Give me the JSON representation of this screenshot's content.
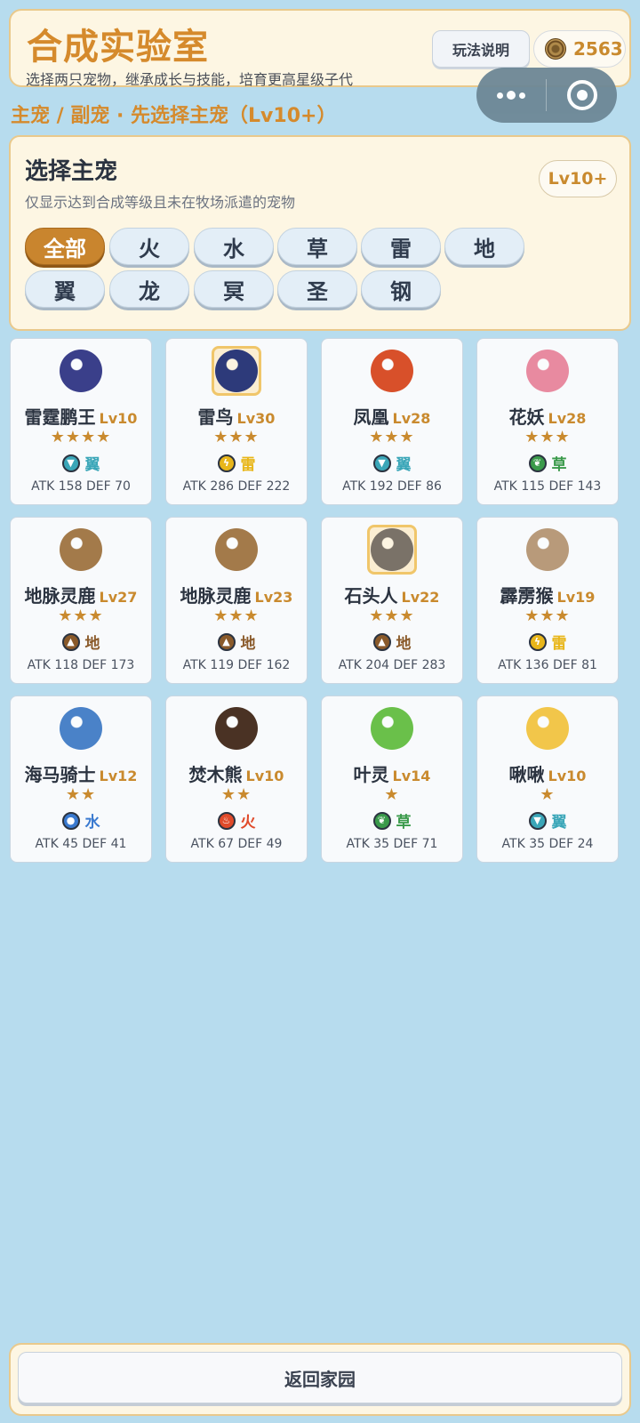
{
  "header": {
    "title": "合成实验室",
    "subtitle": "选择两只宠物，继承成长与技能，培育更高星级子代",
    "help_label": "玩法说明",
    "coins": "2563"
  },
  "breadcrumb": "主宠 / 副宠 · 先选择主宠（Lv10+）",
  "panel": {
    "title": "选择主宠",
    "desc": "仅显示达到合成等级且未在牧场派遣的宠物",
    "level_badge": "Lv10+",
    "filters": [
      "全部",
      "火",
      "水",
      "草",
      "雷",
      "地",
      "翼",
      "龙",
      "冥",
      "圣",
      "钢"
    ],
    "active_filter": "全部"
  },
  "pets": [
    {
      "name": "雷霆鹏王",
      "lv": "Lv10",
      "stars": "★★★★",
      "element": "翼",
      "stats": "ATK 158  DEF 70",
      "icon": "eagle-icon",
      "color": "#3a3f8a",
      "elem_color": "#3aa6b8",
      "framed": false
    },
    {
      "name": "雷鸟",
      "lv": "Lv30",
      "stars": "★★★",
      "element": "雷",
      "stats": "ATK 286  DEF 222",
      "icon": "thunderbird-icon",
      "color": "#2d3a7a",
      "elem_color": "#e8b61a",
      "framed": true
    },
    {
      "name": "凤凰",
      "lv": "Lv28",
      "stars": "★★★",
      "element": "翼",
      "stats": "ATK 192  DEF 86",
      "icon": "phoenix-icon",
      "color": "#d8502a",
      "elem_color": "#3aa6b8",
      "framed": false
    },
    {
      "name": "花妖",
      "lv": "Lv28",
      "stars": "★★★",
      "element": "草",
      "stats": "ATK 115  DEF 143",
      "icon": "flower-fairy-icon",
      "color": "#e88aa0",
      "elem_color": "#3a9a4a",
      "framed": false
    },
    {
      "name": "地脉灵鹿",
      "lv": "Lv27",
      "stars": "★★★",
      "element": "地",
      "stats": "ATK 118  DEF 173",
      "icon": "deer-icon",
      "color": "#a37a4a",
      "elem_color": "#8a5a2a",
      "framed": false
    },
    {
      "name": "地脉灵鹿",
      "lv": "Lv23",
      "stars": "★★★",
      "element": "地",
      "stats": "ATK 119  DEF 162",
      "icon": "deer-icon",
      "color": "#a37a4a",
      "elem_color": "#8a5a2a",
      "framed": false
    },
    {
      "name": "石头人",
      "lv": "Lv22",
      "stars": "★★★",
      "element": "地",
      "stats": "ATK 204  DEF 283",
      "icon": "golem-icon",
      "color": "#7a7268",
      "elem_color": "#8a5a2a",
      "framed": true
    },
    {
      "name": "霹雳猴",
      "lv": "Lv19",
      "stars": "★★★",
      "element": "雷",
      "stats": "ATK 136  DEF 81",
      "icon": "monkey-icon",
      "color": "#b89a7a",
      "elem_color": "#e8b61a",
      "framed": false
    },
    {
      "name": "海马骑士",
      "lv": "Lv12",
      "stars": "★★",
      "element": "水",
      "stats": "ATK 45  DEF 41",
      "icon": "seahorse-icon",
      "color": "#4a82c8",
      "elem_color": "#3a7ad0",
      "framed": false
    },
    {
      "name": "焚木熊",
      "lv": "Lv10",
      "stars": "★★",
      "element": "火",
      "stats": "ATK 67  DEF 49",
      "icon": "bear-icon",
      "color": "#4a3224",
      "elem_color": "#e04a2a",
      "framed": false
    },
    {
      "name": "叶灵",
      "lv": "Lv14",
      "stars": "★",
      "element": "草",
      "stats": "ATK 35  DEF 71",
      "icon": "leaf-spirit-icon",
      "color": "#6ac04a",
      "elem_color": "#3a9a4a",
      "framed": false
    },
    {
      "name": "啾啾",
      "lv": "Lv10",
      "stars": "★",
      "element": "翼",
      "stats": "ATK 35  DEF 24",
      "icon": "chick-icon",
      "color": "#f2c64a",
      "elem_color": "#3aa6b8",
      "framed": false
    }
  ],
  "bottom": {
    "home_label": "返回家园"
  }
}
